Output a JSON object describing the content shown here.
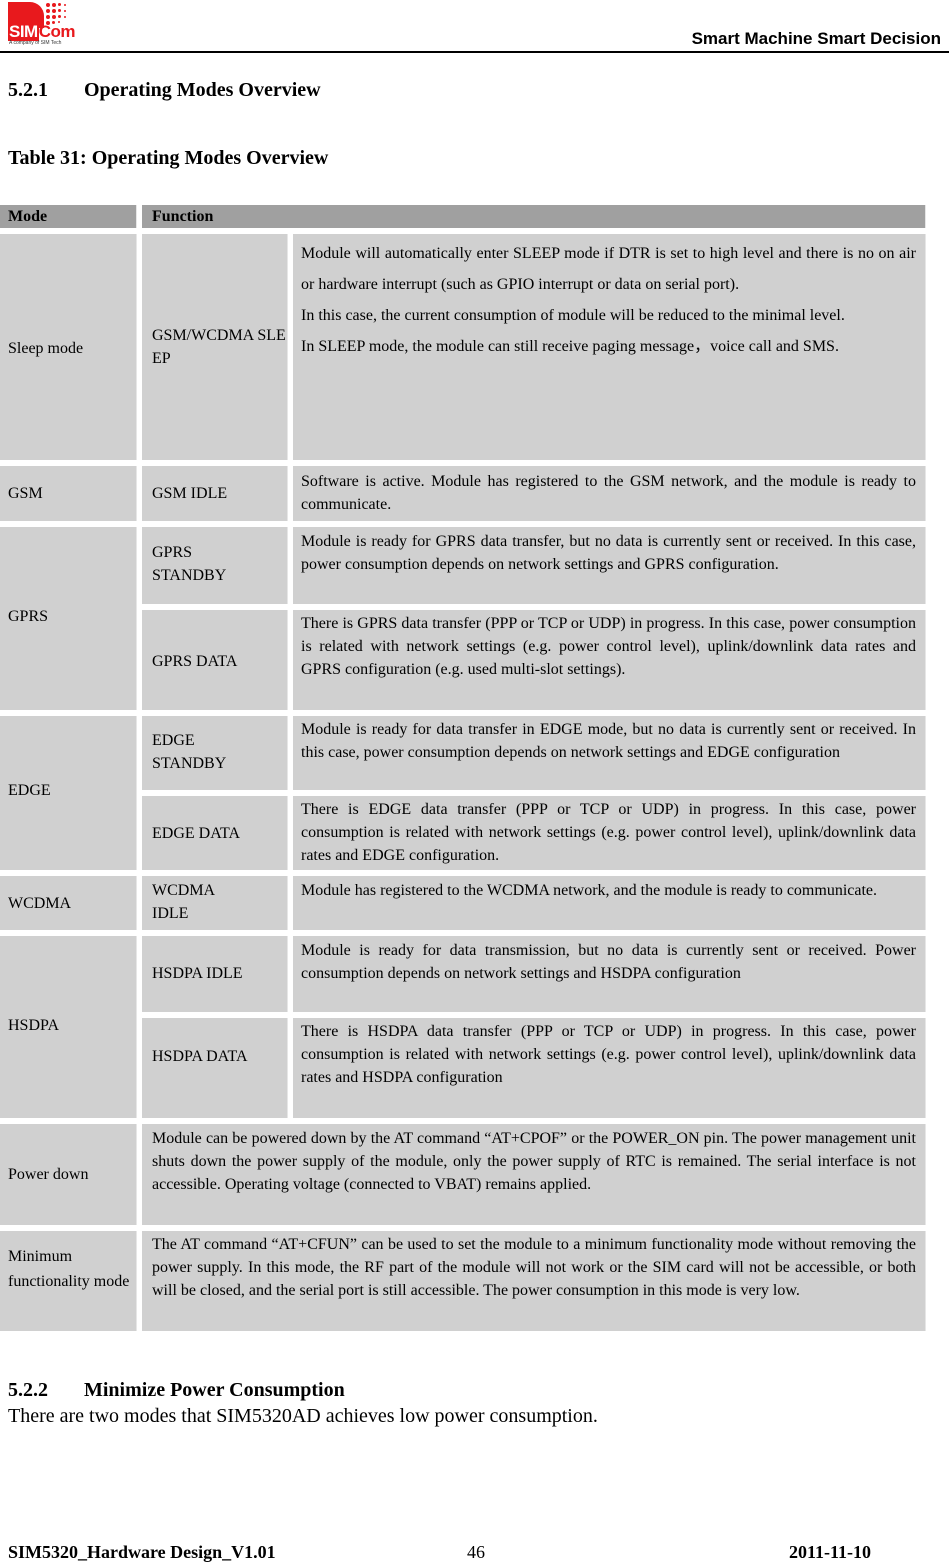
{
  "header": {
    "logo_brand_sim": "SIM",
    "logo_brand_com": "Com",
    "logo_tagline": "A company of SIM Tech",
    "slogan": "Smart Machine Smart Decision"
  },
  "section_1": {
    "number": "5.2.1",
    "title": "Operating Modes Overview"
  },
  "table_caption": "Table 31: Operating Modes Overview",
  "table": {
    "headers": {
      "mode": "Mode",
      "function": "Function"
    },
    "rows": [
      {
        "mode": "Sleep mode",
        "submode": "GSM/WCDMA SLEEP",
        "description": "Module will automatically enter SLEEP mode if DTR is set to high level and there is no on air or hardware interrupt (such as GPIO interrupt or data on serial port).",
        "description_2": "In this case, the current consumption of module will be reduced to the minimal level.",
        "description_3": "In SLEEP mode, the module can still receive paging message，voice call and SMS."
      },
      {
        "mode": "GSM",
        "submode": "GSM IDLE",
        "description": "Software is active. Module has registered to the GSM network, and the module is ready to communicate."
      },
      {
        "mode": "GPRS",
        "submode": "GPRS STANDBY",
        "description": "Module is ready for GPRS data transfer, but no data is currently sent or received. In this case, power consumption depends on network settings and GPRS configuration."
      },
      {
        "mode": "",
        "submode": "GPRS DATA",
        "description": "There is GPRS data transfer (PPP or TCP or UDP) in progress. In this case, power consumption is related with network settings (e.g. power control level), uplink/downlink data rates and GPRS configuration (e.g. used multi-slot settings)."
      },
      {
        "mode": "EDGE",
        "submode": "EDGE STANDBY",
        "description": "Module is ready for data transfer in EDGE mode, but no data is currently sent or received. In this case, power consumption depends on network settings and EDGE configuration"
      },
      {
        "mode": "",
        "submode": "EDGE DATA",
        "description": "There is EDGE data transfer (PPP or TCP or UDP) in progress. In this case, power consumption is related with network settings (e.g. power control level), uplink/downlink data rates and EDGE configuration."
      },
      {
        "mode": "WCDMA",
        "submode": "WCDMA IDLE",
        "description": "Module has registered to the WCDMA network, and the module is ready to communicate."
      },
      {
        "mode": "HSDPA",
        "submode": "HSDPA IDLE",
        "description": "Module is ready for data transmission, but no data is currently sent or received. Power consumption depends on network settings and HSDPA configuration"
      },
      {
        "mode": "",
        "submode": "HSDPA DATA",
        "description": "There is HSDPA data transfer (PPP or TCP or UDP) in progress. In this case, power consumption is related with network settings (e.g. power control level), uplink/downlink data rates and HSDPA configuration"
      },
      {
        "mode": "Power down",
        "submode": "",
        "description": "Module can be powered down by the AT command “AT+CPOF” or the POWER_ON pin. The power management unit shuts down the power supply of the module, only the power supply of RTC is remained. The serial interface is not accessible. Operating voltage (connected to VBAT) remains applied."
      },
      {
        "mode": "Minimum functionality mode",
        "submode": "",
        "description": "The AT command “AT+CFUN” can be used to set the module to a minimum functionality mode without removing the power supply. In this mode, the RF part of the module will not work or the SIM card will not be accessible, or both will be closed, and the serial port is still accessible. The power consumption in this mode is very low."
      }
    ]
  },
  "section_2": {
    "number": "5.2.2",
    "title": "Minimize Power Consumption"
  },
  "paragraph": "There are two modes that SIM5320AD achieves low power consumption.",
  "footer": {
    "doc": "SIM5320_Hardware Design_V1.01",
    "page": "46",
    "date": "2011-11-10"
  }
}
